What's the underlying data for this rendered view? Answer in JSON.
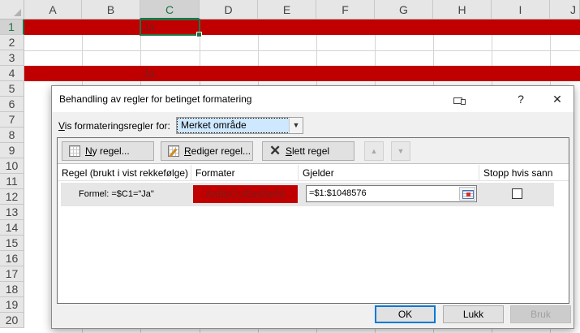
{
  "sheet": {
    "columns": [
      "A",
      "B",
      "C",
      "D",
      "E",
      "F",
      "G",
      "H",
      "I",
      "J"
    ],
    "rows": [
      "1",
      "2",
      "3",
      "4",
      "5",
      "6",
      "7",
      "8",
      "9",
      "10",
      "11",
      "12",
      "13",
      "14",
      "15",
      "16",
      "17",
      "18",
      "19",
      "20"
    ],
    "selected_column": "C",
    "selected_row": "1",
    "cells": {
      "C1": "Ja",
      "C4": "Ja"
    },
    "highlight_color": "#c00000"
  },
  "dialog": {
    "title": "Behandling av regler for betinget formatering",
    "help_label": "?",
    "close_label": "✕",
    "show_rules_prefix": "V",
    "show_rules_rest": "is formateringsregler for:",
    "scope_value": "Merket område",
    "toolbar": {
      "new_rule_prefix": "N",
      "new_rule_rest": "y regel...",
      "edit_rule_prefix": "R",
      "edit_rule_rest": "ediger regel...",
      "delete_rule_prefix": "S",
      "delete_rule_rest": "lett regel",
      "move_up": "▲",
      "move_down": "▼"
    },
    "headers": {
      "rule": "Regel (brukt i vist rekkefølge)",
      "format": "Formater",
      "applies_to": "Gjelder",
      "stop_if_true": "Stopp hvis sann"
    },
    "rules": [
      {
        "name": "Formel: =$C1=\"Ja\"",
        "preview": "AaBbCcÆæØøÅå",
        "preview_color": "#c00000",
        "applies_to": "=$1:$1048576",
        "stop_if_true": false
      }
    ],
    "buttons": {
      "ok": "OK",
      "close": "Lukk",
      "apply": "Bruk"
    }
  }
}
